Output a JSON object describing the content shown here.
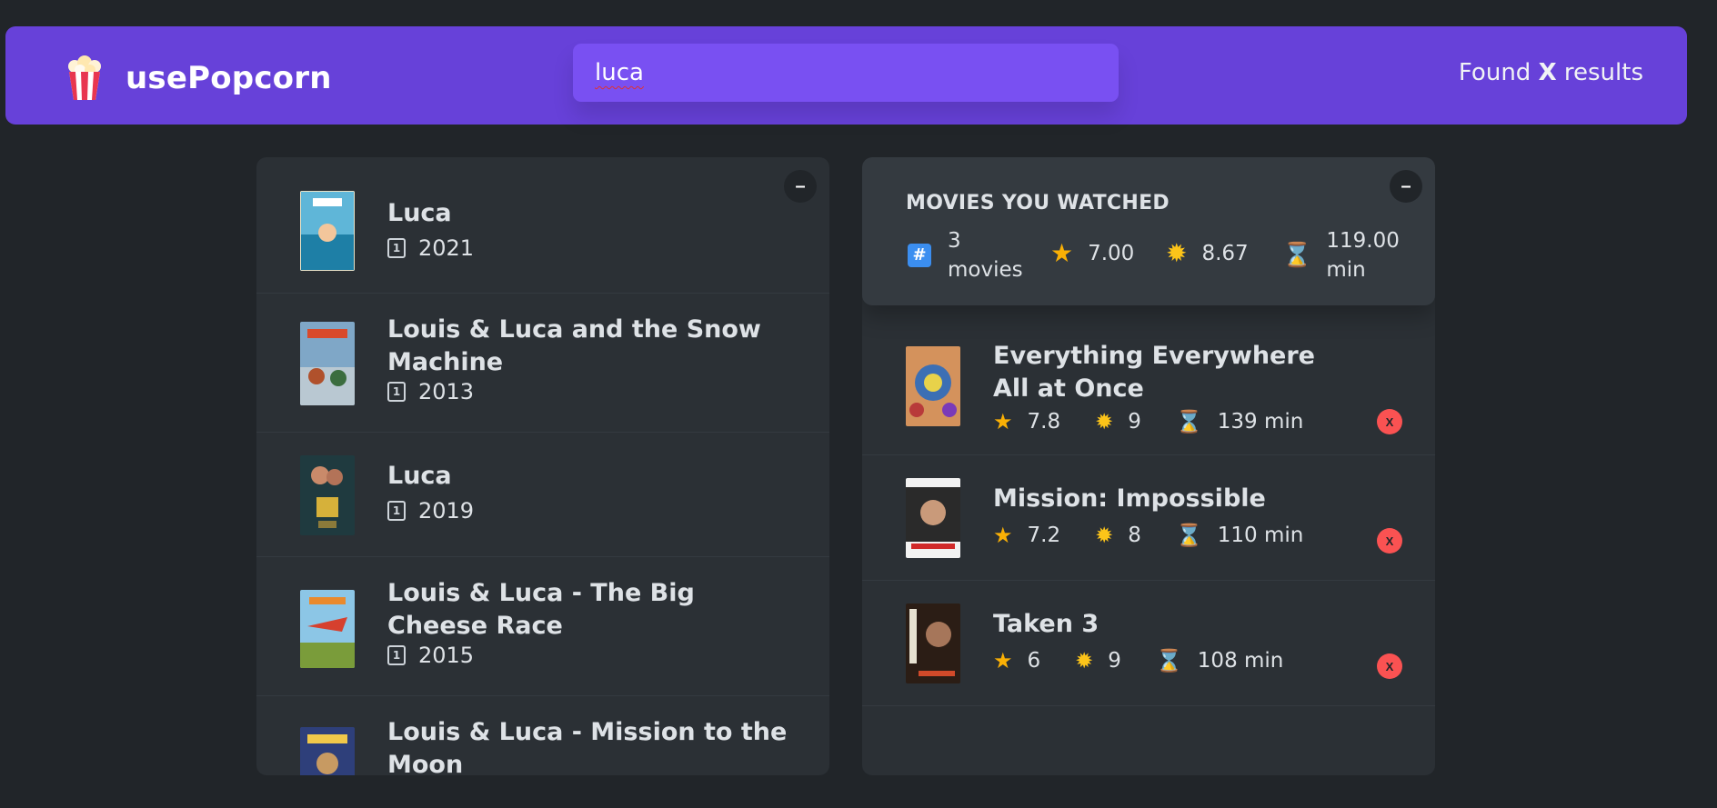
{
  "nav": {
    "logo_text": "usePopcorn",
    "logo_icon": "popcorn-icon",
    "search_value": "luca",
    "results_prefix": "Found",
    "results_count": "X",
    "results_suffix": "results"
  },
  "search_results": {
    "toggle_label": "–",
    "movies": [
      {
        "title": "Luca",
        "year": "2021"
      },
      {
        "title": "Louis & Luca and the Snow Machine",
        "year": "2013"
      },
      {
        "title": "Luca",
        "year": "2019"
      },
      {
        "title": "Louis & Luca - The Big Cheese Race",
        "year": "2015"
      },
      {
        "title": "Louis & Luca - Mission to the Moon",
        "year": ""
      }
    ]
  },
  "watched": {
    "toggle_label": "–",
    "summary": {
      "heading": "MOVIES YOU WATCHED",
      "count_num": "3",
      "count_unit": "movies",
      "avg_imdb": "7.00",
      "avg_user": "8.67",
      "avg_runtime_num": "119.00",
      "avg_runtime_unit": "min"
    },
    "movies": [
      {
        "title": "Everything Everywhere All at Once",
        "imdb": "7.8",
        "user": "9",
        "runtime": "139 min",
        "delete_label": "X"
      },
      {
        "title": "Mission: Impossible",
        "imdb": "7.2",
        "user": "8",
        "runtime": "110 min",
        "delete_label": "X"
      },
      {
        "title": "Taken 3",
        "imdb": "6",
        "user": "9",
        "runtime": "108 min",
        "delete_label": "X"
      }
    ]
  },
  "icons": {
    "calendar": "calendar-icon",
    "hash": "hash-icon",
    "star": "star-icon",
    "sun": "sun-icon",
    "hourglass": "hourglass-icon"
  },
  "colors": {
    "background": "#212529",
    "nav": "#6741d9",
    "search": "#7950f2",
    "box": "#2b3035",
    "summary": "#343a40",
    "delete": "#fa5252"
  }
}
